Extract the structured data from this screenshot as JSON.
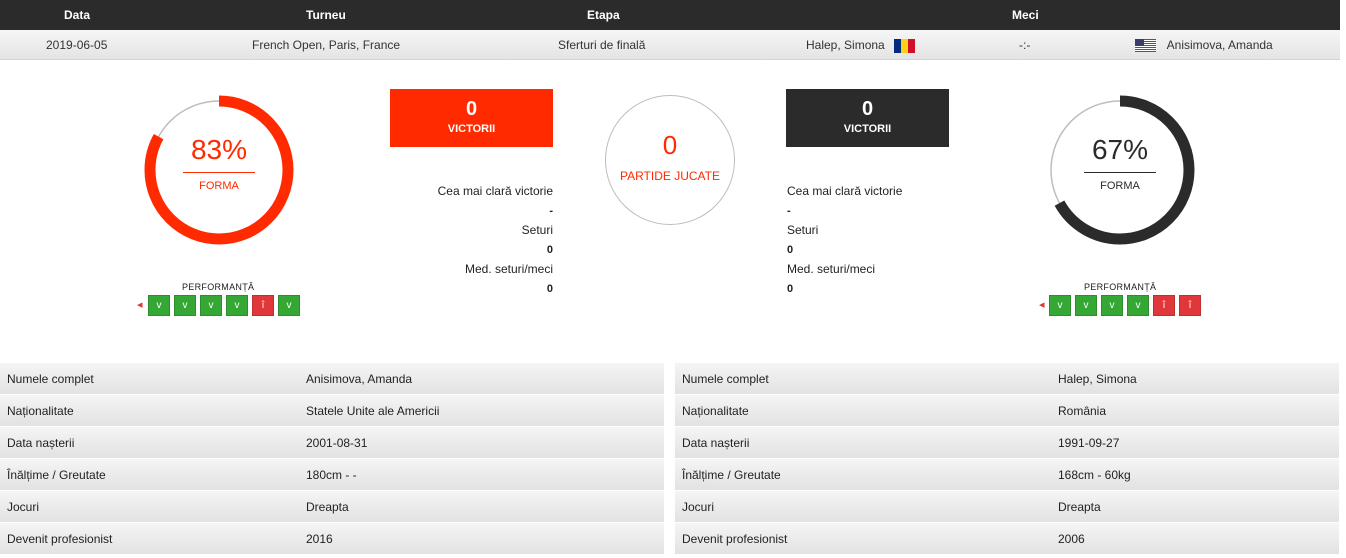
{
  "header": {
    "date_label": "Data",
    "tournament_label": "Turneu",
    "stage_label": "Etapa",
    "match_label": "Meci"
  },
  "match": {
    "date": "2019-06-05",
    "tournament": "French Open, Paris, France",
    "stage": "Sferturi de finală",
    "player1": "Halep, Simona",
    "player1_flag": "romania-flag",
    "score": "-:-",
    "player2": "Anisimova, Amanda",
    "player2_flag": "usa-flag"
  },
  "left": {
    "form_pct": "83%",
    "form_value": 83,
    "form_label": "FORMA",
    "color": "#ff2a00",
    "performance_label": "PERFORMANȚĂ",
    "performance": [
      "V",
      "V",
      "V",
      "V",
      "Î",
      "V"
    ],
    "wins": "0",
    "wins_label": "VICTORII",
    "clear_victory_label": "Cea mai clară victorie",
    "clear_victory": "-",
    "sets_label": "Seturi",
    "sets": "0",
    "avg_sets_label": "Med. seturi/meci",
    "avg_sets": "0"
  },
  "center": {
    "played": "0",
    "played_label": "PARTIDE JUCATE",
    "color": "#ff2a00"
  },
  "right": {
    "form_pct": "67%",
    "form_value": 67,
    "form_label": "FORMA",
    "color": "#2b2b2b",
    "performance_label": "PERFORMANȚĂ",
    "performance": [
      "V",
      "V",
      "V",
      "V",
      "Î",
      "Î"
    ],
    "wins": "0",
    "wins_label": "VICTORII",
    "clear_victory_label": "Cea mai clară victorie",
    "clear_victory": "-",
    "sets_label": "Seturi",
    "sets": "0",
    "avg_sets_label": "Med. seturi/meci",
    "avg_sets": "0"
  },
  "info_left": [
    {
      "label": "Numele complet",
      "value": "Anisimova, Amanda"
    },
    {
      "label": "Naționalitate",
      "value": "Statele Unite ale Americii"
    },
    {
      "label": "Data nașterii",
      "value": "2001-08-31"
    },
    {
      "label": "Înălțime / Greutate",
      "value": "180cm - -"
    },
    {
      "label": "Jocuri",
      "value": "Dreapta"
    },
    {
      "label": "Devenit profesionist",
      "value": "2016"
    }
  ],
  "info_right": [
    {
      "label": "Numele complet",
      "value": "Halep, Simona"
    },
    {
      "label": "Naționalitate",
      "value": "România"
    },
    {
      "label": "Data nașterii",
      "value": "1991-09-27"
    },
    {
      "label": "Înălțime / Greutate",
      "value": "168cm - 60kg"
    },
    {
      "label": "Jocuri",
      "value": "Dreapta"
    },
    {
      "label": "Devenit profesionist",
      "value": "2006"
    }
  ]
}
